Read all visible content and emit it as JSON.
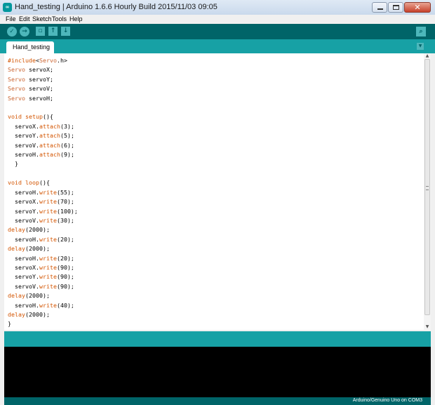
{
  "window": {
    "title": "Hand_testing | Arduino 1.6.6 Hourly Build 2015/11/03 09:05",
    "app_icon_text": "∞",
    "close_glyph": "✕"
  },
  "menu": [
    "File",
    "Edit",
    "Sketch",
    "Tools",
    "Help"
  ],
  "toolbar": {
    "verify_icon": "check-icon",
    "upload_icon": "arrow-right-icon",
    "new_icon": "new-file-icon",
    "open_icon": "arrow-up-icon",
    "save_icon": "arrow-down-icon",
    "serial_monitor_icon": "magnifier-icon"
  },
  "tabs": [
    {
      "label": "Hand_testing"
    }
  ],
  "editor": {
    "lines": [
      "#include<Servo.h>",
      "Servo servoX;",
      "Servo servoY;",
      "Servo servoV;",
      "Servo servoH;",
      "",
      "void setup(){",
      "  servoX.attach(3);",
      "  servoY.attach(5);",
      "  servoV.attach(6);",
      "  servoH.attach(9);",
      "  }",
      "",
      "void loop(){",
      "  servoH.write(55);",
      "  servoX.write(70);",
      "  servoY.write(100);",
      "  servoV.write(30);",
      "delay(2000);",
      "  servoH.write(20);",
      "delay(2000);",
      "  servoH.write(20);",
      "  servoX.write(90);",
      "  servoY.write(90);",
      "  servoV.write(90);",
      "delay(2000);",
      "  servoH.write(40);",
      "delay(2000);",
      "}"
    ]
  },
  "status": {
    "board": "Arduino/Genuino Uno on COM3"
  },
  "colors": {
    "toolbar": "#006468",
    "tabbar": "#17a1a5",
    "keyword": "#d35400"
  }
}
